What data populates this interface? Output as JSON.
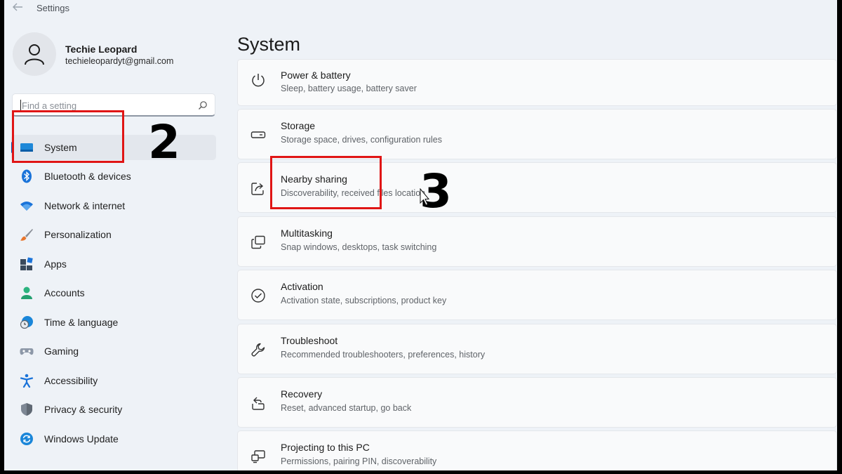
{
  "window": {
    "title": "Settings"
  },
  "user": {
    "name": "Techie Leopard",
    "email": "techieleopardyt@gmail.com"
  },
  "search": {
    "placeholder": "Find a setting"
  },
  "sidebar": {
    "items": [
      {
        "label": "System",
        "icon": "system-icon",
        "selected": true
      },
      {
        "label": "Bluetooth & devices",
        "icon": "bluetooth-icon"
      },
      {
        "label": "Network & internet",
        "icon": "wifi-icon"
      },
      {
        "label": "Personalization",
        "icon": "brush-icon"
      },
      {
        "label": "Apps",
        "icon": "apps-icon"
      },
      {
        "label": "Accounts",
        "icon": "accounts-icon"
      },
      {
        "label": "Time & language",
        "icon": "time-language-icon"
      },
      {
        "label": "Gaming",
        "icon": "gamepad-icon"
      },
      {
        "label": "Accessibility",
        "icon": "accessibility-icon"
      },
      {
        "label": "Privacy & security",
        "icon": "shield-icon"
      },
      {
        "label": "Windows Update",
        "icon": "update-icon"
      }
    ]
  },
  "main": {
    "title": "System",
    "cards": [
      {
        "title": "Power & battery",
        "desc": "Sleep, battery usage, battery saver",
        "icon": "power-icon"
      },
      {
        "title": "Storage",
        "desc": "Storage space, drives, configuration rules",
        "icon": "storage-icon"
      },
      {
        "title": "Nearby sharing",
        "desc": "Discoverability, received files location",
        "icon": "share-icon"
      },
      {
        "title": "Multitasking",
        "desc": "Snap windows, desktops, task switching",
        "icon": "multitasking-icon"
      },
      {
        "title": "Activation",
        "desc": "Activation state, subscriptions, product key",
        "icon": "activation-icon"
      },
      {
        "title": "Troubleshoot",
        "desc": "Recommended troubleshooters, preferences, history",
        "icon": "wrench-icon"
      },
      {
        "title": "Recovery",
        "desc": "Reset, advanced startup, go back",
        "icon": "recovery-icon"
      },
      {
        "title": "Projecting to this PC",
        "desc": "Permissions, pairing PIN, discoverability",
        "icon": "projecting-icon"
      }
    ]
  },
  "annotations": {
    "step2": "2",
    "step3": "3",
    "highlight_color": "#e01515"
  },
  "colors": {
    "accent": "#005fb8",
    "window_bg": "#eef2f7",
    "card_bg": "#f9fafb"
  }
}
